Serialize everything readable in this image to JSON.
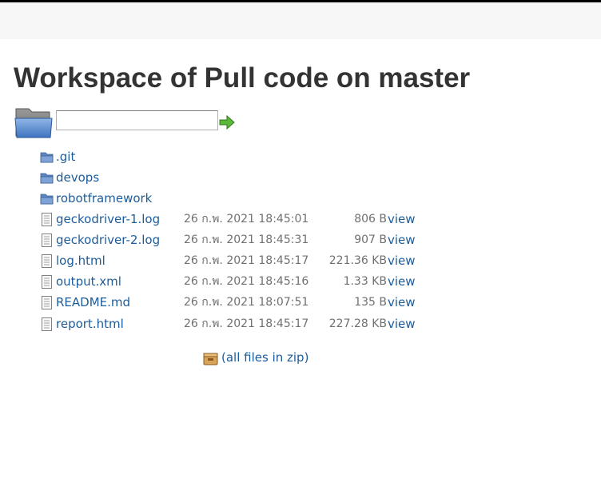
{
  "page": {
    "title": "Workspace of Pull code on master"
  },
  "navigator": {
    "path_value": "",
    "go_icon": "green-arrow-right-icon",
    "folder_icon": "large-folder-icon"
  },
  "files": [
    {
      "name": ".git",
      "type": "folder",
      "date": "",
      "size": "",
      "view": ""
    },
    {
      "name": "devops",
      "type": "folder",
      "date": "",
      "size": "",
      "view": ""
    },
    {
      "name": "robotframework",
      "type": "folder",
      "date": "",
      "size": "",
      "view": ""
    },
    {
      "name": "geckodriver-1.log",
      "type": "file",
      "date": "26 ก.พ. 2021 18:45:01",
      "size": "806 B",
      "view": "view"
    },
    {
      "name": "geckodriver-2.log",
      "type": "file",
      "date": "26 ก.พ. 2021 18:45:31",
      "size": "907 B",
      "view": "view"
    },
    {
      "name": "log.html",
      "type": "file",
      "date": "26 ก.พ. 2021 18:45:17",
      "size": "221.36 KB",
      "view": "view"
    },
    {
      "name": "output.xml",
      "type": "file",
      "date": "26 ก.พ. 2021 18:45:16",
      "size": "1.33 KB",
      "view": "view"
    },
    {
      "name": "README.md",
      "type": "file",
      "date": "26 ก.พ. 2021 18:07:51",
      "size": "135 B",
      "view": "view"
    },
    {
      "name": "report.html",
      "type": "file",
      "date": "26 ก.พ. 2021 18:45:17",
      "size": "227.28 KB",
      "view": "view"
    }
  ],
  "zip": {
    "label": "(all files in zip)",
    "icon": "package-icon"
  },
  "colors": {
    "link": "#1d5c9b",
    "meta_text": "#707070",
    "title_text": "#333333",
    "topbar": "#f7f7f7"
  }
}
